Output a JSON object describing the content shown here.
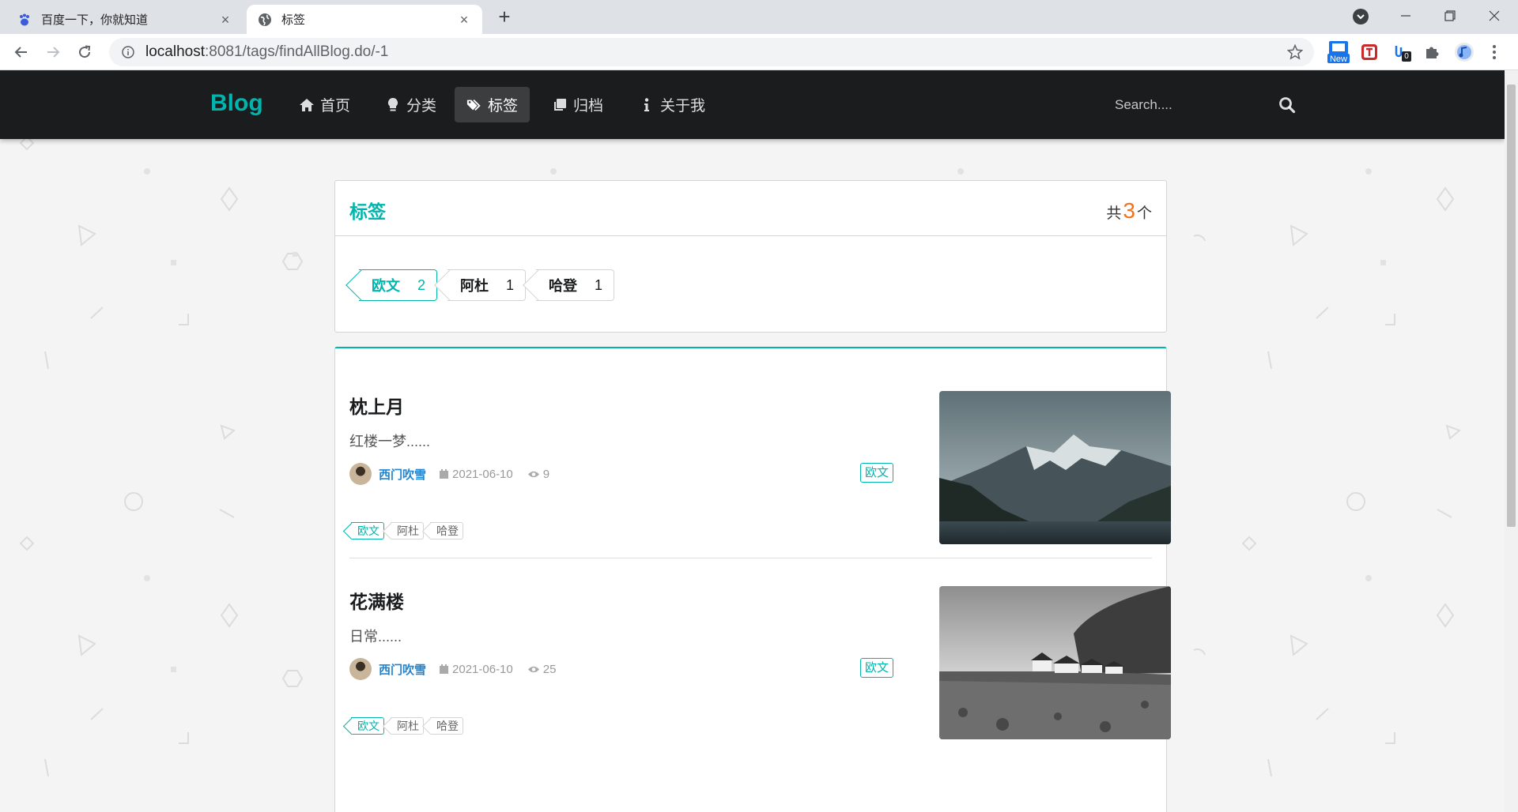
{
  "browser": {
    "tabs": [
      {
        "title": "百度一下，你就知道",
        "icon": "baidu-paw-icon",
        "active": false
      },
      {
        "title": "标签",
        "icon": "globe-icon",
        "active": true
      }
    ],
    "url_host": "localhost",
    "url_path": ":8081/tags/findAllBlog.do/-1",
    "extension_badge_new": "New",
    "extension_badge_count": "0"
  },
  "nav": {
    "brand": "Blog",
    "items": [
      {
        "label": "首页",
        "icon": "home-icon"
      },
      {
        "label": "分类",
        "icon": "lightbulb-icon"
      },
      {
        "label": "标签",
        "icon": "tags-icon",
        "active": true
      },
      {
        "label": "归档",
        "icon": "clone-icon"
      },
      {
        "label": "关于我",
        "icon": "info-icon"
      }
    ],
    "search_placeholder": "Search...."
  },
  "tags_panel": {
    "title": "标签",
    "count_prefix": "共",
    "count": "3",
    "count_suffix": "个",
    "tags": [
      {
        "name": "欧文",
        "count": "2",
        "active": true
      },
      {
        "name": "阿杜",
        "count": "1",
        "active": false
      },
      {
        "name": "哈登",
        "count": "1",
        "active": false
      }
    ]
  },
  "posts": [
    {
      "title": "枕上月",
      "excerpt": "红楼一梦......",
      "author": "西门吹雪",
      "date": "2021-06-10",
      "views": "9",
      "type": "欧文",
      "tags": [
        "欧文",
        "阿杜",
        "哈登"
      ],
      "image": "mountain-lake-photo"
    },
    {
      "title": "花满楼",
      "excerpt": "日常......",
      "author": "西门吹雪",
      "date": "2021-06-10",
      "views": "25",
      "type": "欧文",
      "tags": [
        "欧文",
        "阿杜",
        "哈登"
      ],
      "image": "coastal-houses-photo"
    }
  ],
  "floating_badge": "0",
  "colors": {
    "teal": "#00b5ad",
    "orange": "#f2711c",
    "nav_bg": "#1b1c1d",
    "link_blue": "#2185d0",
    "badge_purple": "#6b1a6e"
  }
}
